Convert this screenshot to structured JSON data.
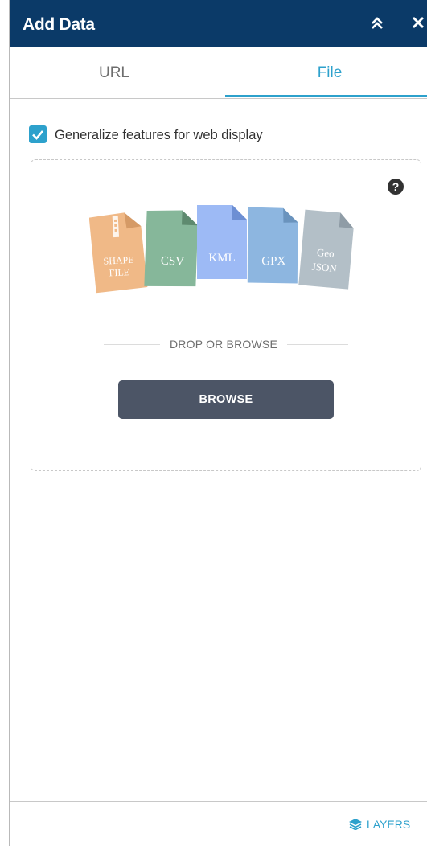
{
  "header": {
    "title": "Add Data",
    "collapse_icon": "double-chevron-up-icon",
    "close_icon": "close-icon"
  },
  "tabs": [
    {
      "label": "URL",
      "active": false
    },
    {
      "label": "File",
      "active": true
    }
  ],
  "options": {
    "generalize_label": "Generalize features for web display",
    "generalize_checked": true
  },
  "drop_zone": {
    "help_icon": "question-circle-icon",
    "file_types": [
      {
        "label": "SHAPE FILE",
        "lines": [
          "SHAPE",
          "FILE"
        ],
        "color": "#f0b987"
      },
      {
        "label": "CSV",
        "lines": [
          "CSV"
        ],
        "color": "#86b79a"
      },
      {
        "label": "KML",
        "lines": [
          "KML"
        ],
        "color": "#9dbaf5"
      },
      {
        "label": "GPX",
        "lines": [
          "GPX"
        ],
        "color": "#8db6e0"
      },
      {
        "label": "Geo JSON",
        "lines": [
          "Geo",
          "JSON"
        ],
        "color": "#b3bfc7"
      }
    ],
    "drop_text": "DROP OR BROWSE",
    "browse_label": "BROWSE"
  },
  "footer": {
    "layers_label": "LAYERS",
    "layers_icon": "layers-icon"
  },
  "colors": {
    "header_bg": "#0b3a68",
    "accent": "#2da1cc",
    "button_bg": "#4c5566"
  }
}
